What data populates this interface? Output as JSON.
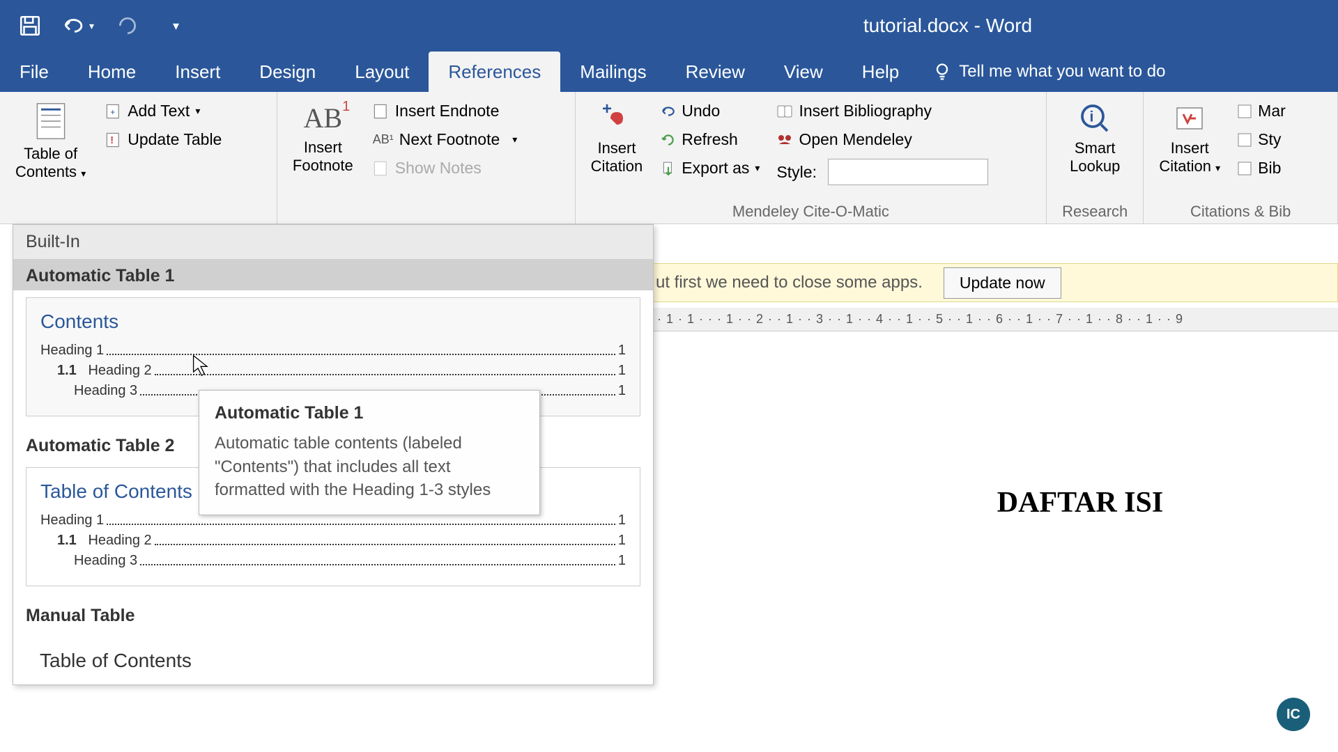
{
  "title": "tutorial.docx - Word",
  "tabs": {
    "file": "File",
    "home": "Home",
    "insert": "Insert",
    "design": "Design",
    "layout": "Layout",
    "references": "References",
    "mailings": "Mailings",
    "review": "Review",
    "view": "View",
    "help": "Help",
    "tellme": "Tell me what you want to do"
  },
  "ribbon": {
    "toc": "Table of\nContents",
    "add_text": "Add Text",
    "update_table": "Update Table",
    "insert_footnote": "Insert\nFootnote",
    "insert_endnote": "Insert Endnote",
    "next_footnote": "Next Footnote",
    "show_notes": "Show Notes",
    "insert_citation": "Insert\nCitation",
    "undo": "Undo",
    "refresh": "Refresh",
    "export_as": "Export as",
    "insert_bib": "Insert Bibliography",
    "open_mendeley": "Open Mendeley",
    "style": "Style:",
    "mendeley_group": "Mendeley Cite-O-Matic",
    "smart_lookup": "Smart\nLookup",
    "research_group": "Research",
    "insert_citation2": "Insert\nCitation",
    "citations_group": "Citations & Bib",
    "mar": "Mar",
    "sty": "Sty",
    "bib": "Bib"
  },
  "dropdown": {
    "builtin": "Built-In",
    "auto1": "Automatic Table 1",
    "auto2": "Automatic Table 2",
    "manual": "Manual Table",
    "contents": "Contents",
    "toc_title": "Table of Contents",
    "h1": "Heading 1",
    "h2_num": "1.1",
    "h2": "Heading 2",
    "h3": "Heading 3",
    "page": "1"
  },
  "tooltip": {
    "title": "Automatic Table 1",
    "desc": "Automatic table contents (labeled \"Contents\") that includes all text formatted with the Heading 1-3 styles"
  },
  "notif": {
    "text": "ut first we need to close some apps.",
    "btn": "Update now"
  },
  "ruler": "· · 1 · 1 · · · 1 · · 2 · · 1 · · 3 · · 1 · · 4 · · 1 · · 5 · · 1 · · 6 · · 1 · · 7 · · 1 · · 8 · · 1 · · 9",
  "doc": {
    "title": "DAFTAR ISI"
  },
  "badge": "IC"
}
